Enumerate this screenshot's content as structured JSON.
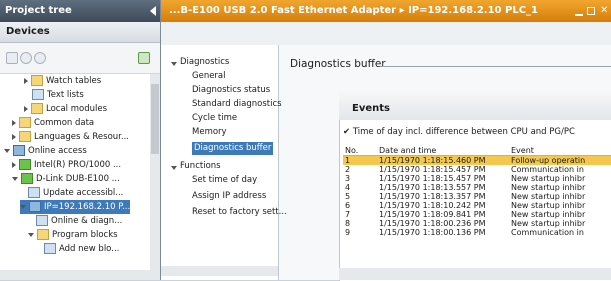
{
  "project_tree": {
    "title": "Project tree",
    "tab": "Devices",
    "items": [
      {
        "label": "Watch tables",
        "expand": "closed",
        "icon": "folder"
      },
      {
        "label": "Text lists",
        "expand": "none",
        "icon": "list"
      },
      {
        "label": "Local modules",
        "expand": "closed",
        "icon": "folder"
      },
      {
        "label": "Common data",
        "expand": "closed",
        "icon": "folder"
      },
      {
        "label": "Languages & Resour...",
        "expand": "closed",
        "icon": "folder"
      },
      {
        "label": "Online access",
        "expand": "open",
        "icon": "cpu"
      },
      {
        "label": "Intel(R) PRO/1000 ...",
        "expand": "closed",
        "icon": "network"
      },
      {
        "label": "D-Link DUB-E100 ...",
        "expand": "open",
        "icon": "network"
      },
      {
        "label": "Update accessibl...",
        "expand": "none",
        "icon": "update"
      },
      {
        "label": "IP=192.168.2.10 P...",
        "expand": "open",
        "icon": "cpu",
        "selected": true
      },
      {
        "label": "Online & diagn...",
        "expand": "none",
        "icon": "diag"
      },
      {
        "label": "Program blocks",
        "expand": "open",
        "icon": "folder"
      },
      {
        "label": "Add new blo...",
        "expand": "none",
        "icon": "add"
      }
    ]
  },
  "title_bar": {
    "text": "...B-E100 USB 2.0 Fast Ethernet Adapter ▸ IP=192.168.2.10 PLC_1"
  },
  "nav": {
    "diagnostics_label": "Diagnostics",
    "diagnostics_items": [
      "General",
      "Diagnostics status",
      "Standard diagnostics",
      "Cycle time",
      "Memory",
      "Diagnostics buffer"
    ],
    "selected": "Diagnostics buffer",
    "functions_label": "Functions",
    "functions_items": [
      "Set time of day",
      "Assign IP address",
      "Reset to factory sett..."
    ]
  },
  "main": {
    "section_title": "Diagnostics buffer",
    "events_tab": "Events",
    "tod_checkbox_label": "Time of day incl. difference between CPU and PG/PC",
    "tod_checked": true,
    "columns": [
      "No.",
      "Date and time",
      "Event"
    ],
    "rows": [
      {
        "no": "1",
        "date": "1/15/1970 1:18:15.460 PM",
        "event": "Follow-up operatin",
        "selected": true
      },
      {
        "no": "2",
        "date": "1/15/1970 1:18:15.457 PM",
        "event": "Communication in"
      },
      {
        "no": "3",
        "date": "1/15/1970 1:18:15.457 PM",
        "event": "New startup inhibr"
      },
      {
        "no": "4",
        "date": "1/15/1970 1:18:13.557 PM",
        "event": "New startup inhibr"
      },
      {
        "no": "5",
        "date": "1/15/1970 1:18:13.357 PM",
        "event": "New startup inhibr"
      },
      {
        "no": "6",
        "date": "1/15/1970 1:18:10.242 PM",
        "event": "New startup inhibr"
      },
      {
        "no": "7",
        "date": "1/15/1970 1:18:09.841 PM",
        "event": "New startup inhibr"
      },
      {
        "no": "8",
        "date": "1/15/1970 1:18:00.236 PM",
        "event": "New startup inhibr"
      },
      {
        "no": "9",
        "date": "1/15/1970 1:18:00.136 PM",
        "event": "Communication in"
      }
    ]
  },
  "colors": {
    "accent_orange": "#e08a12",
    "selection_blue": "#3e7ab9",
    "row_highlight": "#f4c74f"
  }
}
